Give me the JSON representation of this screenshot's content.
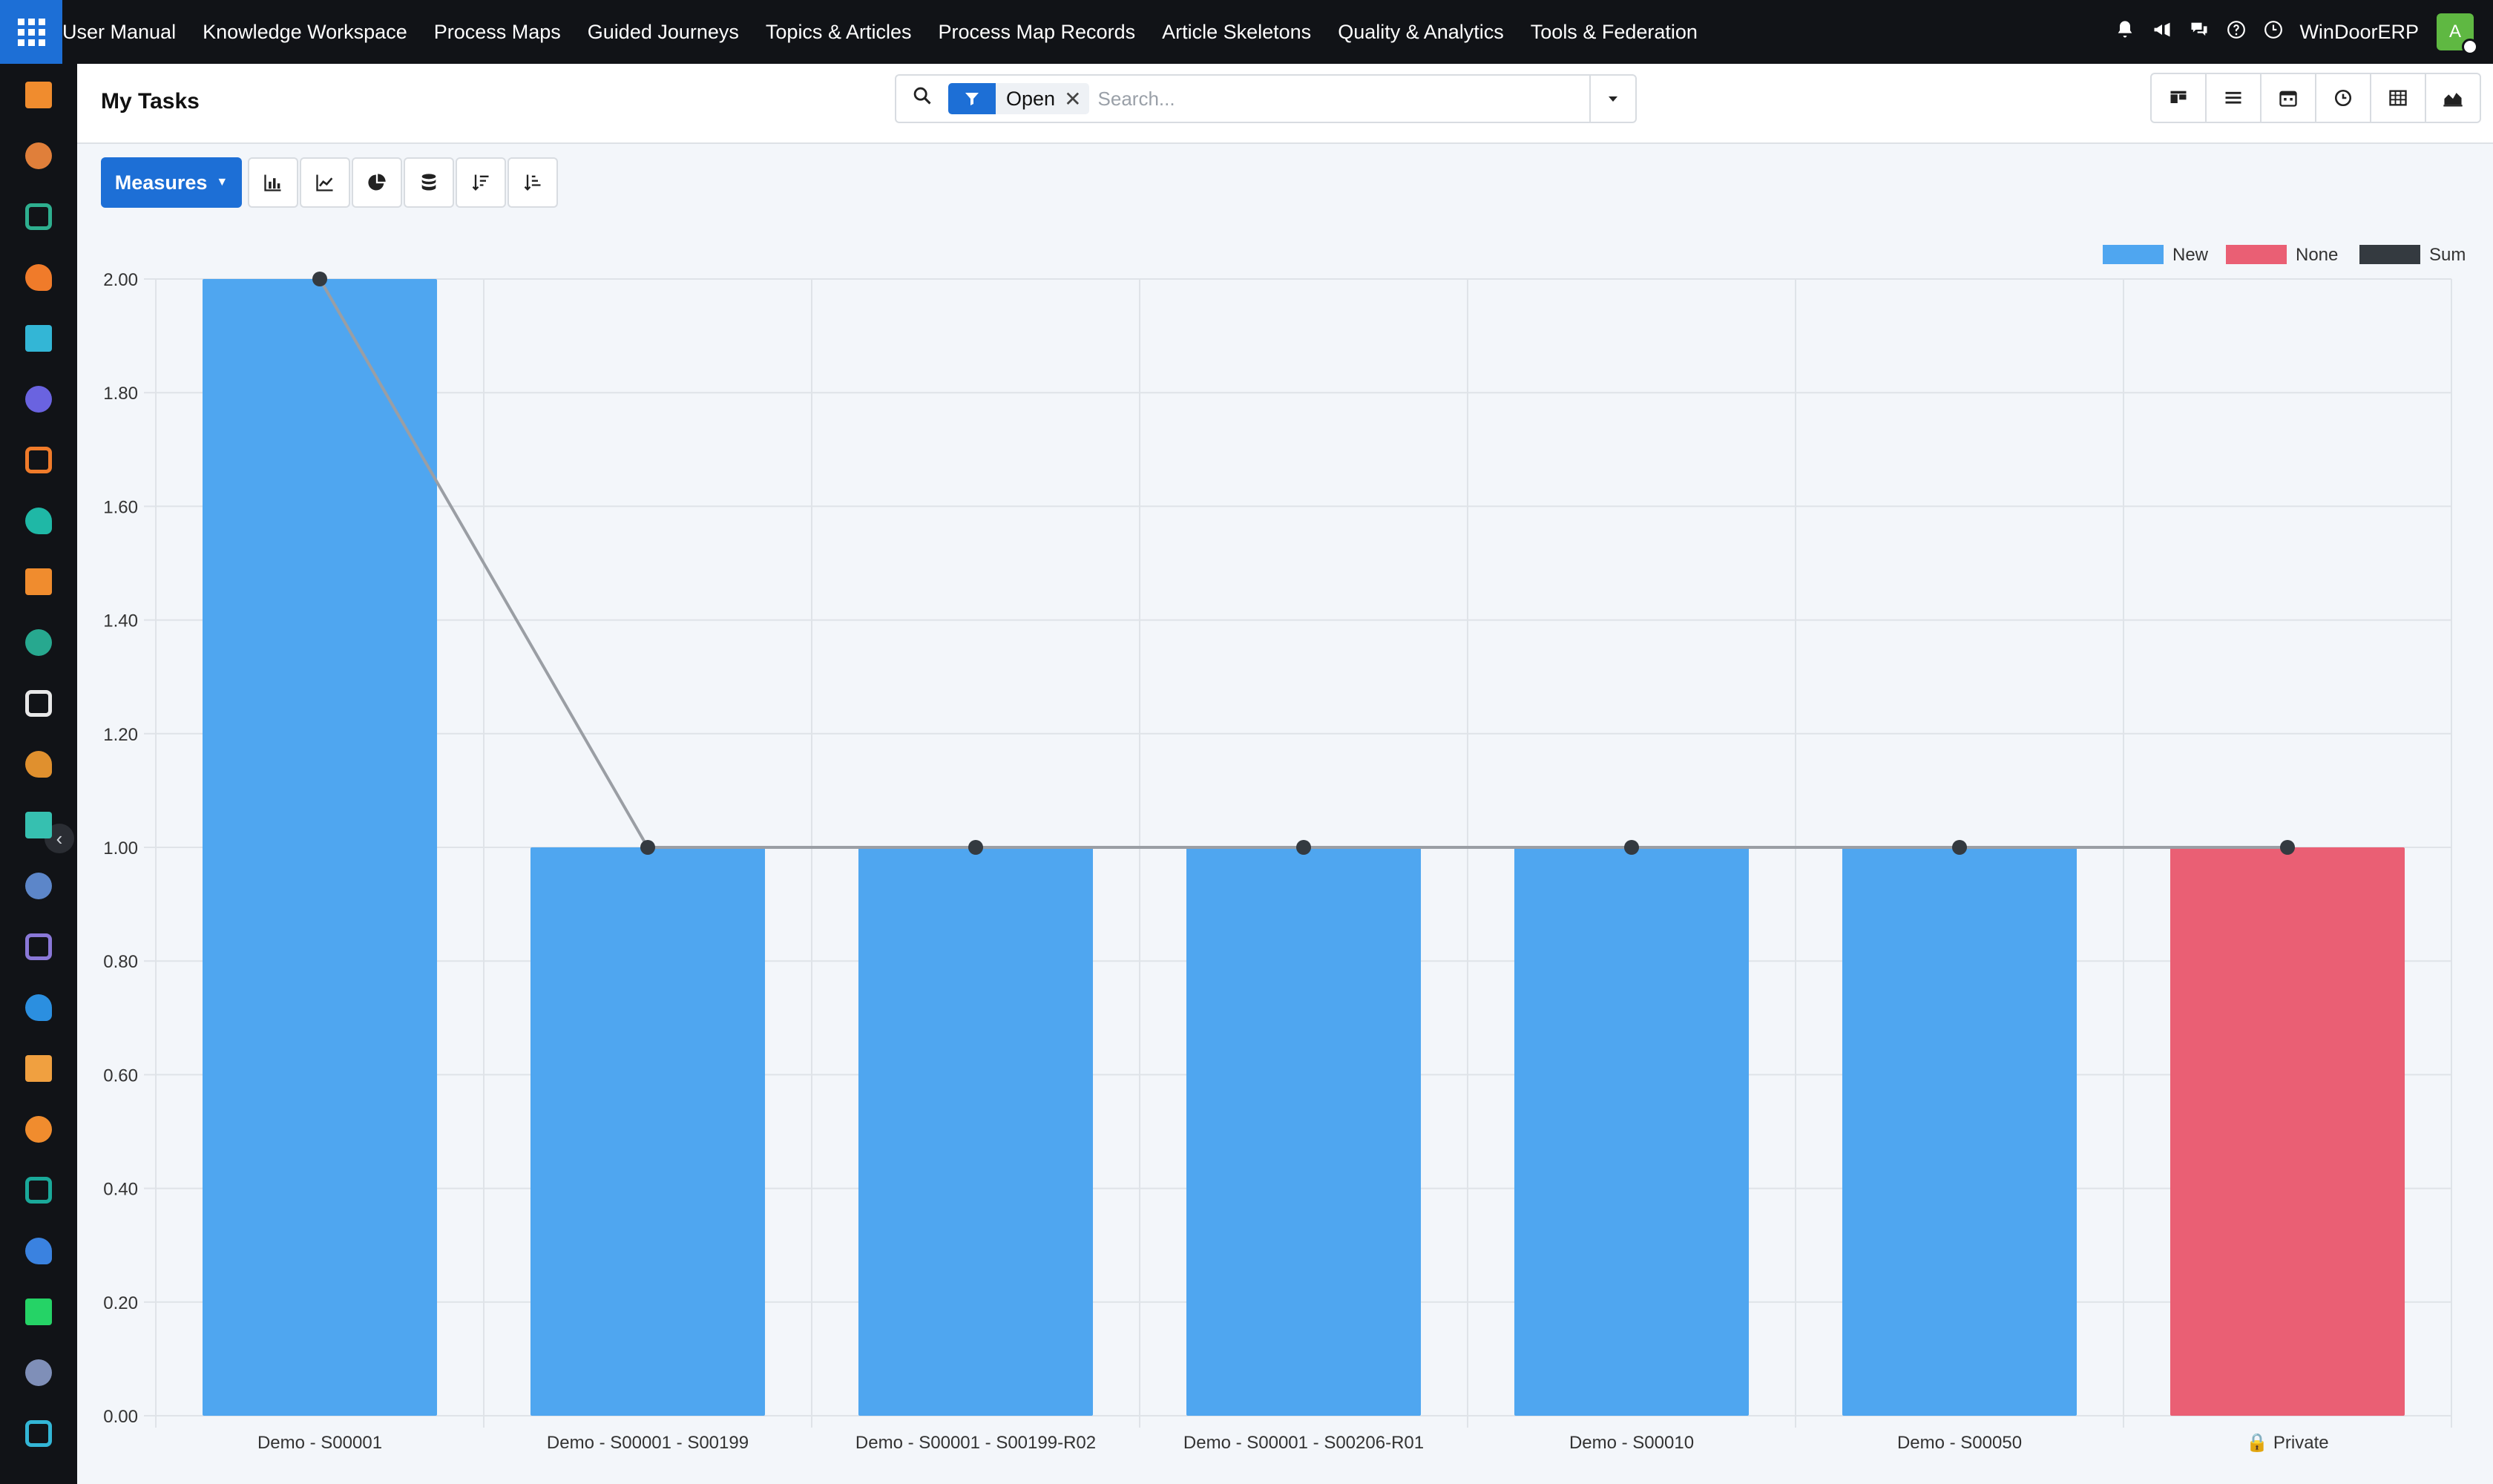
{
  "navbar": {
    "menu": [
      "User Manual",
      "Knowledge Workspace",
      "Process Maps",
      "Guided Journeys",
      "Topics & Articles",
      "Process Map Records",
      "Article Skeletons",
      "Quality & Analytics",
      "Tools & Federation"
    ],
    "company": "WinDoorERP",
    "avatar_initial": "A",
    "icons": [
      "bell-icon",
      "megaphone-icon",
      "chat-icon",
      "help-icon",
      "clock-icon"
    ]
  },
  "sidebar": {
    "icon_colors": [
      "#f08c2e",
      "#e07f3a",
      "#2eaf8f",
      "#f07b2a",
      "#33b6d6",
      "#6a63e0",
      "#f07b2a",
      "#1fb8a6",
      "#f08c2e",
      "#27a88f",
      "#e8e8e8",
      "#e0902e",
      "#36c0b0",
      "#5c86c9",
      "#8a78d8",
      "#2b8fe0",
      "#f0a040",
      "#f08c2e",
      "#1aa99a",
      "#3a82e0",
      "#25d366",
      "#7f8fb8",
      "#33b6d6"
    ]
  },
  "panel": {
    "title": "My Tasks",
    "facet_label": "Open",
    "search_placeholder": "Search..."
  },
  "toolbar": {
    "measures_label": "Measures"
  },
  "colors": {
    "accent": "#1d6fd6",
    "new": "#4fa6f0",
    "none": "#ea5f74",
    "sum": "#343a40"
  },
  "chart_data": {
    "type": "bar",
    "categories": [
      "Demo - S00001",
      "Demo - S00001 - S00199",
      "Demo - S00001 - S00199-R02",
      "Demo - S00001 - S00206-R01",
      "Demo - S00010",
      "Demo - S00050",
      "🔒 Private"
    ],
    "series": [
      {
        "name": "New",
        "values": [
          2,
          1,
          1,
          1,
          1,
          1,
          0
        ],
        "color": "#4fa6f0"
      },
      {
        "name": "None",
        "values": [
          0,
          0,
          0,
          0,
          0,
          0,
          1
        ],
        "color": "#ea5f74"
      },
      {
        "name": "Sum",
        "type": "line",
        "values": [
          2,
          1,
          1,
          1,
          1,
          1,
          1
        ],
        "color": "#343a40"
      }
    ],
    "ylim": [
      0,
      2
    ],
    "yticks": [
      "0.00",
      "0.20",
      "0.40",
      "0.60",
      "0.80",
      "1.00",
      "1.20",
      "1.40",
      "1.60",
      "1.80",
      "2.00"
    ],
    "legend": [
      "New",
      "None",
      "Sum"
    ],
    "legend_position": "top-right",
    "grid": true,
    "stacked": true
  }
}
